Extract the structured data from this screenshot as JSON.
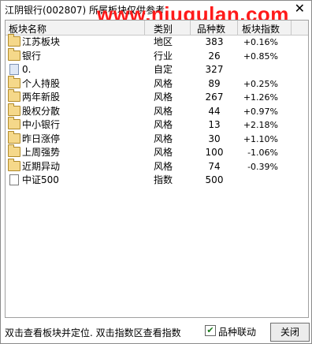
{
  "window": {
    "title": "江阴银行(002807) 所属板块仅供参考",
    "close_glyph": "✕",
    "watermark": "www.niugulan.com"
  },
  "table": {
    "columns": [
      "板块名称",
      "类别",
      "品种数",
      "板块指数"
    ],
    "rows": [
      {
        "icon": "folder-icon",
        "name": "江苏板块",
        "type": "地区",
        "count": "383",
        "index": "+0.16%"
      },
      {
        "icon": "folder-icon",
        "name": "银行",
        "type": "行业",
        "count": "26",
        "index": "+0.85%"
      },
      {
        "icon": "file-blue-icon",
        "name": "0.",
        "type": "自定",
        "count": "327",
        "index": ""
      },
      {
        "icon": "folder-icon",
        "name": "个人持股",
        "type": "风格",
        "count": "89",
        "index": "+0.25%"
      },
      {
        "icon": "folder-icon",
        "name": "两年新股",
        "type": "风格",
        "count": "267",
        "index": "+1.26%"
      },
      {
        "icon": "folder-icon",
        "name": "股权分散",
        "type": "风格",
        "count": "44",
        "index": "+0.97%"
      },
      {
        "icon": "folder-icon",
        "name": "中小银行",
        "type": "风格",
        "count": "13",
        "index": "+2.18%"
      },
      {
        "icon": "folder-icon",
        "name": "昨日涨停",
        "type": "风格",
        "count": "30",
        "index": "+1.10%"
      },
      {
        "icon": "folder-icon",
        "name": "上周强势",
        "type": "风格",
        "count": "100",
        "index": "-1.06%"
      },
      {
        "icon": "folder-icon",
        "name": "近期异动",
        "type": "风格",
        "count": "74",
        "index": "-0.39%"
      },
      {
        "icon": "file-icon",
        "name": "中证500",
        "type": "指数",
        "count": "500",
        "index": ""
      }
    ]
  },
  "footer": {
    "status_text": "双击查看板块并定位. 双击指数区查看指数",
    "checkbox_label": "品种联动",
    "checkbox_checked": true,
    "checkbox_glyph": "✔",
    "close_button": "关闭"
  },
  "colors": {
    "watermark": "#ff1a1a",
    "folder": "#f5d88a",
    "check": "#1a7a1a"
  }
}
